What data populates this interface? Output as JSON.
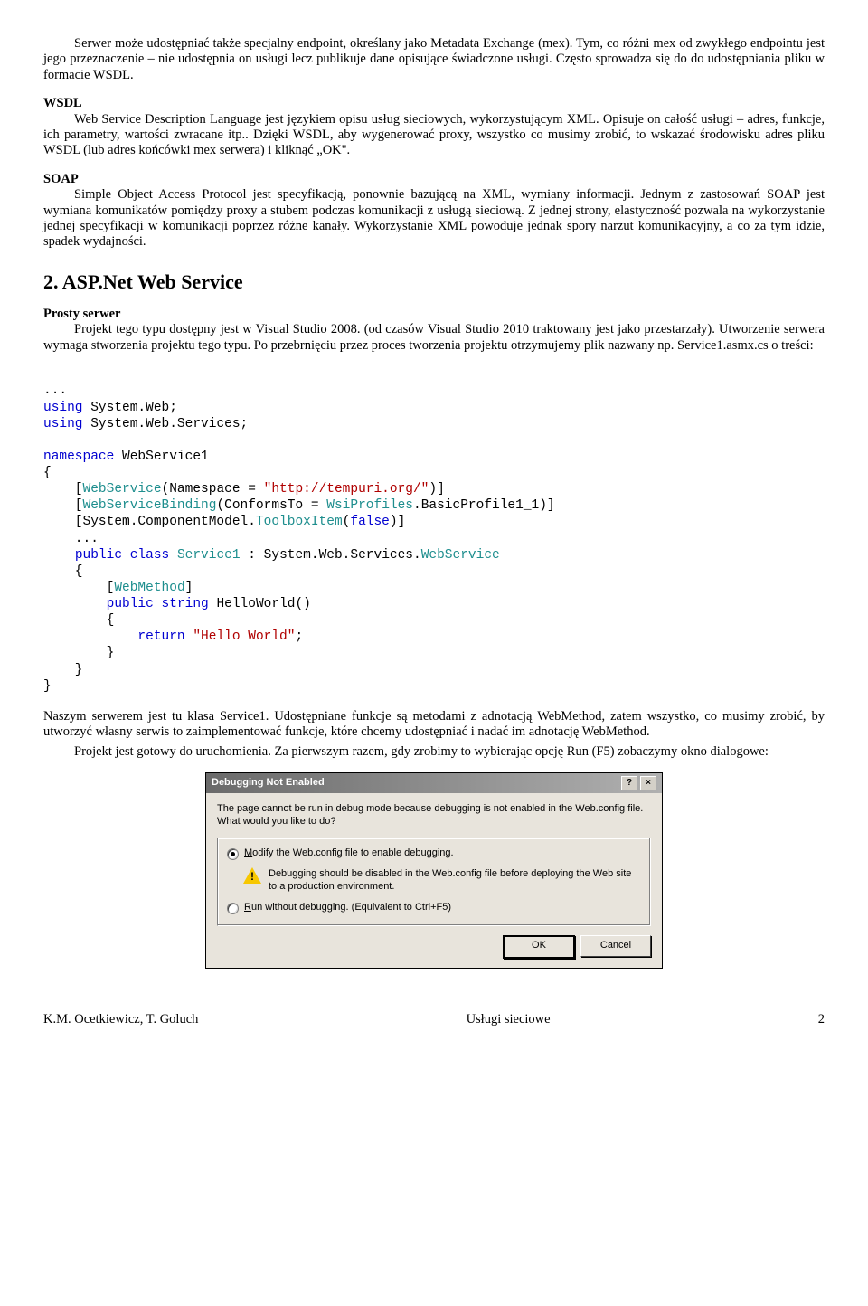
{
  "intro_paragraph": "Serwer może udostępniać także specjalny endpoint, określany jako Metadata Exchange (mex). Tym, co różni mex od zwykłego endpointu jest jego przeznaczenie – nie udostępnia on usługi lecz publikuje dane opisujące świadczone usługi. Często sprowadza się do do udostępniania pliku w formacie WSDL.",
  "wsdl": {
    "label": "WSDL",
    "body": "Web Service Description Language jest językiem opisu usług sieciowych, wykorzystującym XML. Opisuje on całość usługi – adres, funkcje, ich parametry, wartości zwracane itp.. Dzięki WSDL, aby wygenerować proxy, wszystko co musimy zrobić, to wskazać środowisku adres pliku WSDL (lub adres końcówki mex serwera) i kliknąć „OK\"."
  },
  "soap": {
    "label": "SOAP",
    "body": "Simple Object Access Protocol jest specyfikacją, ponownie bazującą na XML, wymiany informacji. Jednym z zastosowań SOAP jest wymiana komunikatów pomiędzy proxy a stubem podczas komunikacji z usługą sieciową. Z jednej strony, elastyczność pozwala na wykorzystanie jednej specyfikacji w komunikacji poprzez różne kanały. Wykorzystanie XML powoduje jednak spory narzut komunikacyjny, a co za tym idzie, spadek wydajności."
  },
  "heading2": "2. ASP.Net Web Service",
  "prosty": {
    "label": "Prosty serwer",
    "body": "Projekt tego typu dostępny jest w Visual Studio 2008. (od czasów Visual Studio 2010 traktowany jest jako przestarzały). Utworzenie serwera wymaga stworzenia projektu tego typu. Po przebrnięciu przez proces tworzenia projektu otrzymujemy plik nazwany np. Service1.asmx.cs o treści:"
  },
  "code": {
    "dots": "...",
    "using1a": "using",
    "using1b": " System.Web;",
    "using2a": "using",
    "using2b": " System.Web.Services;",
    "ns_kw": "namespace",
    "ns_name": " WebService1",
    "lb": "{",
    "rb": "}",
    "attr1_a": "    [",
    "attr1_b": "WebService",
    "attr1_c": "(Namespace = ",
    "attr1_d": "\"http://tempuri.org/\"",
    "attr1_e": ")]",
    "attr2_a": "    [",
    "attr2_b": "WebServiceBinding",
    "attr2_c": "(ConformsTo = ",
    "attr2_d": "WsiProfiles",
    "attr2_e": ".BasicProfile1_1)]",
    "attr3_a": "    [System.ComponentModel.",
    "attr3_b": "ToolboxItem",
    "attr3_c": "(",
    "attr3_d": "false",
    "attr3_e": ")]",
    "dots2": "    ...",
    "cls_a": "    ",
    "cls_b": "public class ",
    "cls_c": "Service1",
    "cls_d": " : System.Web.Services.",
    "cls_e": "WebService",
    "lb2": "    {",
    "wm_a": "        [",
    "wm_b": "WebMethod",
    "wm_c": "]",
    "fn_a": "        ",
    "fn_b": "public string",
    "fn_c": " HelloWorld()",
    "lb3": "        {",
    "ret_a": "            ",
    "ret_b": "return ",
    "ret_c": "\"Hello World\"",
    "ret_d": ";",
    "rb3": "        }",
    "rb2": "    }"
  },
  "after_code_p1": "Naszym serwerem jest tu klasa Service1. Udostępniane funkcje są metodami z adnotacją WebMethod, zatem wszystko, co musimy zrobić, by utworzyć własny serwis to zaimplementować funkcje, które chcemy udostępniać i nadać im adnotację WebMethod.",
  "after_code_p2": "Projekt jest gotowy do uruchomienia. Za pierwszym razem, gdy zrobimy to wybierając opcję Run (F5) zobaczymy okno dialogowe:",
  "dialog": {
    "title": "Debugging Not Enabled",
    "help": "?",
    "close": "×",
    "msg": "The page cannot be run in debug mode because debugging is not enabled in the Web.config file.  What would you like to do?",
    "opt1_pre": "",
    "opt1_u": "M",
    "opt1_post": "odify the Web.config file to enable debugging.",
    "warn": "Debugging should be disabled in the Web.config file before deploying the Web site to a production environment.",
    "opt2_pre": "",
    "opt2_u": "R",
    "opt2_post": "un without debugging. (Equivalent to Ctrl+F5)",
    "ok": "OK",
    "cancel": "Cancel"
  },
  "footer": {
    "left": "K.M. Ocetkiewicz, T. Goluch",
    "center": "Usługi sieciowe",
    "right": "2"
  }
}
